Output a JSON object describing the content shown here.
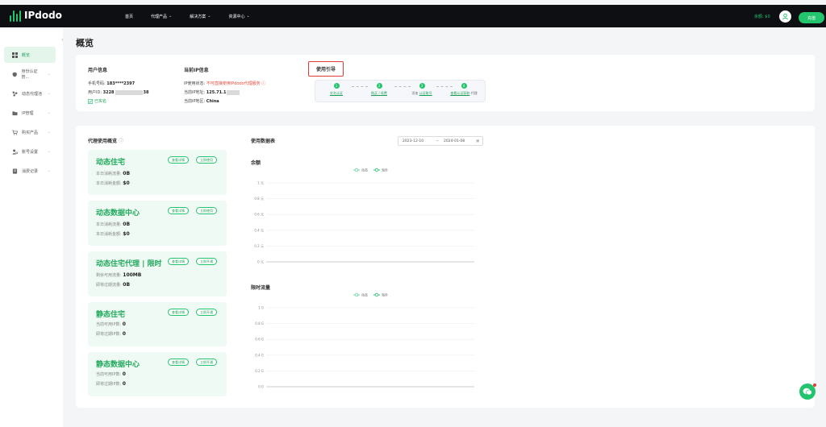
{
  "brand": {
    "name": "IPdodo"
  },
  "topnav": {
    "items": [
      {
        "label": "首页",
        "has_chevron": false
      },
      {
        "label": "代理产品",
        "has_chevron": true
      },
      {
        "label": "解决方案",
        "has_chevron": true
      },
      {
        "label": "资源中心",
        "has_chevron": true
      }
    ],
    "balance": "余额: $0",
    "recharge": "充值"
  },
  "sidebar": {
    "items": [
      {
        "label": "概览",
        "icon": "grid-icon",
        "active": true,
        "has_chevron": false
      },
      {
        "label": "身份认证管...",
        "icon": "shield-icon",
        "active": false,
        "has_chevron": true
      },
      {
        "label": "动态代理池",
        "icon": "network-icon",
        "active": false,
        "has_chevron": true
      },
      {
        "label": "IP管理",
        "icon": "folder-icon",
        "active": false,
        "has_chevron": true
      },
      {
        "label": "购买产品",
        "icon": "cart-icon",
        "active": false,
        "has_chevron": true
      },
      {
        "label": "账号设置",
        "icon": "user-gear-icon",
        "active": false,
        "has_chevron": true
      },
      {
        "label": "消费记录",
        "icon": "receipt-icon",
        "active": false,
        "has_chevron": true
      }
    ]
  },
  "page": {
    "title": "概览"
  },
  "user_info": {
    "title": "用户信息",
    "phone_label": "手机号码:",
    "phone_value": "183****2397",
    "uid_label": "用户ID:",
    "uid_value": "3228",
    "uid_tail": "38",
    "verified": "已实名"
  },
  "ip_info": {
    "title": "当前IP信息",
    "status_label": "IP使用状态:",
    "status_value": "不可直接使用IPdodo代理服务",
    "ip_label": "当前IP地址:",
    "ip_value": "125.71.1",
    "region_label": "当前IP地区:",
    "region_value": "China"
  },
  "guide": {
    "title": "使用引导",
    "steps": [
      {
        "num": "1",
        "label": "实名认证",
        "prefix": ""
      },
      {
        "num": "2",
        "label": "购买 / 续费",
        "prefix": ""
      },
      {
        "num": "3",
        "label": "认证账号",
        "prefix": "添加"
      },
      {
        "num": "4",
        "label": "查看认证获取",
        "prefix": "",
        "suffix": "代理"
      }
    ]
  },
  "overview": {
    "title": "代理使用概览",
    "products": [
      {
        "name": "动态住宅",
        "btn1": "查看详情",
        "btn2": "立即使用",
        "line1_label": "本日消耗流量:",
        "line1_value": "0B",
        "line2_label": "本日消耗金额:",
        "line2_value": "$0"
      },
      {
        "name": "动态数据中心",
        "btn1": "查看详情",
        "btn2": "立即使用",
        "line1_label": "本日消耗流量:",
        "line1_value": "0B",
        "line2_label": "本日消耗金额:",
        "line2_value": "$0"
      },
      {
        "name": "动态住宅代理 | 限时",
        "btn1": "查看详情",
        "btn2": "立即开通",
        "line1_label": "剩余可用流量:",
        "line1_value": "100MB",
        "line2_label": "即将过期流量:",
        "line2_value": "0B"
      },
      {
        "name": "静态住宅",
        "btn1": "查看详情",
        "btn2": "立即开通",
        "line1_label": "当前可用IP数:",
        "line1_value": "0",
        "line2_label": "即将过期IP数:",
        "line2_value": "0"
      },
      {
        "name": "静态数据中心",
        "btn1": "查看详情",
        "btn2": "立即开通",
        "line1_label": "当前可用IP数:",
        "line1_value": "0",
        "line2_label": "即将过期IP数:",
        "line2_value": "0"
      }
    ]
  },
  "usage": {
    "title": "使用数据表",
    "date_start": "2023-12-10",
    "date_sep": "→",
    "date_end": "2024-01-08",
    "calendar_icon": "calendar-icon"
  },
  "chart_data": [
    {
      "type": "line",
      "title": "余额",
      "series": [
        {
          "name": "动态",
          "values": []
        },
        {
          "name": "海外",
          "values": []
        }
      ],
      "y_ticks": [
        "1 元",
        "0.8 元",
        "0.6 元",
        "0.4 元",
        "0.2 元",
        "0 元"
      ],
      "ylim": [
        0,
        1
      ],
      "legend": "top-center",
      "colors": {
        "series1": "#6ad6a0",
        "series2": "#22c46d"
      }
    },
    {
      "type": "line",
      "title": "限时流量",
      "series": [
        {
          "name": "动态",
          "values": []
        },
        {
          "name": "海外",
          "values": []
        }
      ],
      "y_ticks": [
        "1 G",
        "0.8 G",
        "0.6 G",
        "0.4 G",
        "0.2 G",
        "0 G"
      ],
      "ylim": [
        0,
        1
      ],
      "legend": "top-center",
      "colors": {
        "series1": "#6ad6a0",
        "series2": "#22c46d"
      }
    }
  ]
}
